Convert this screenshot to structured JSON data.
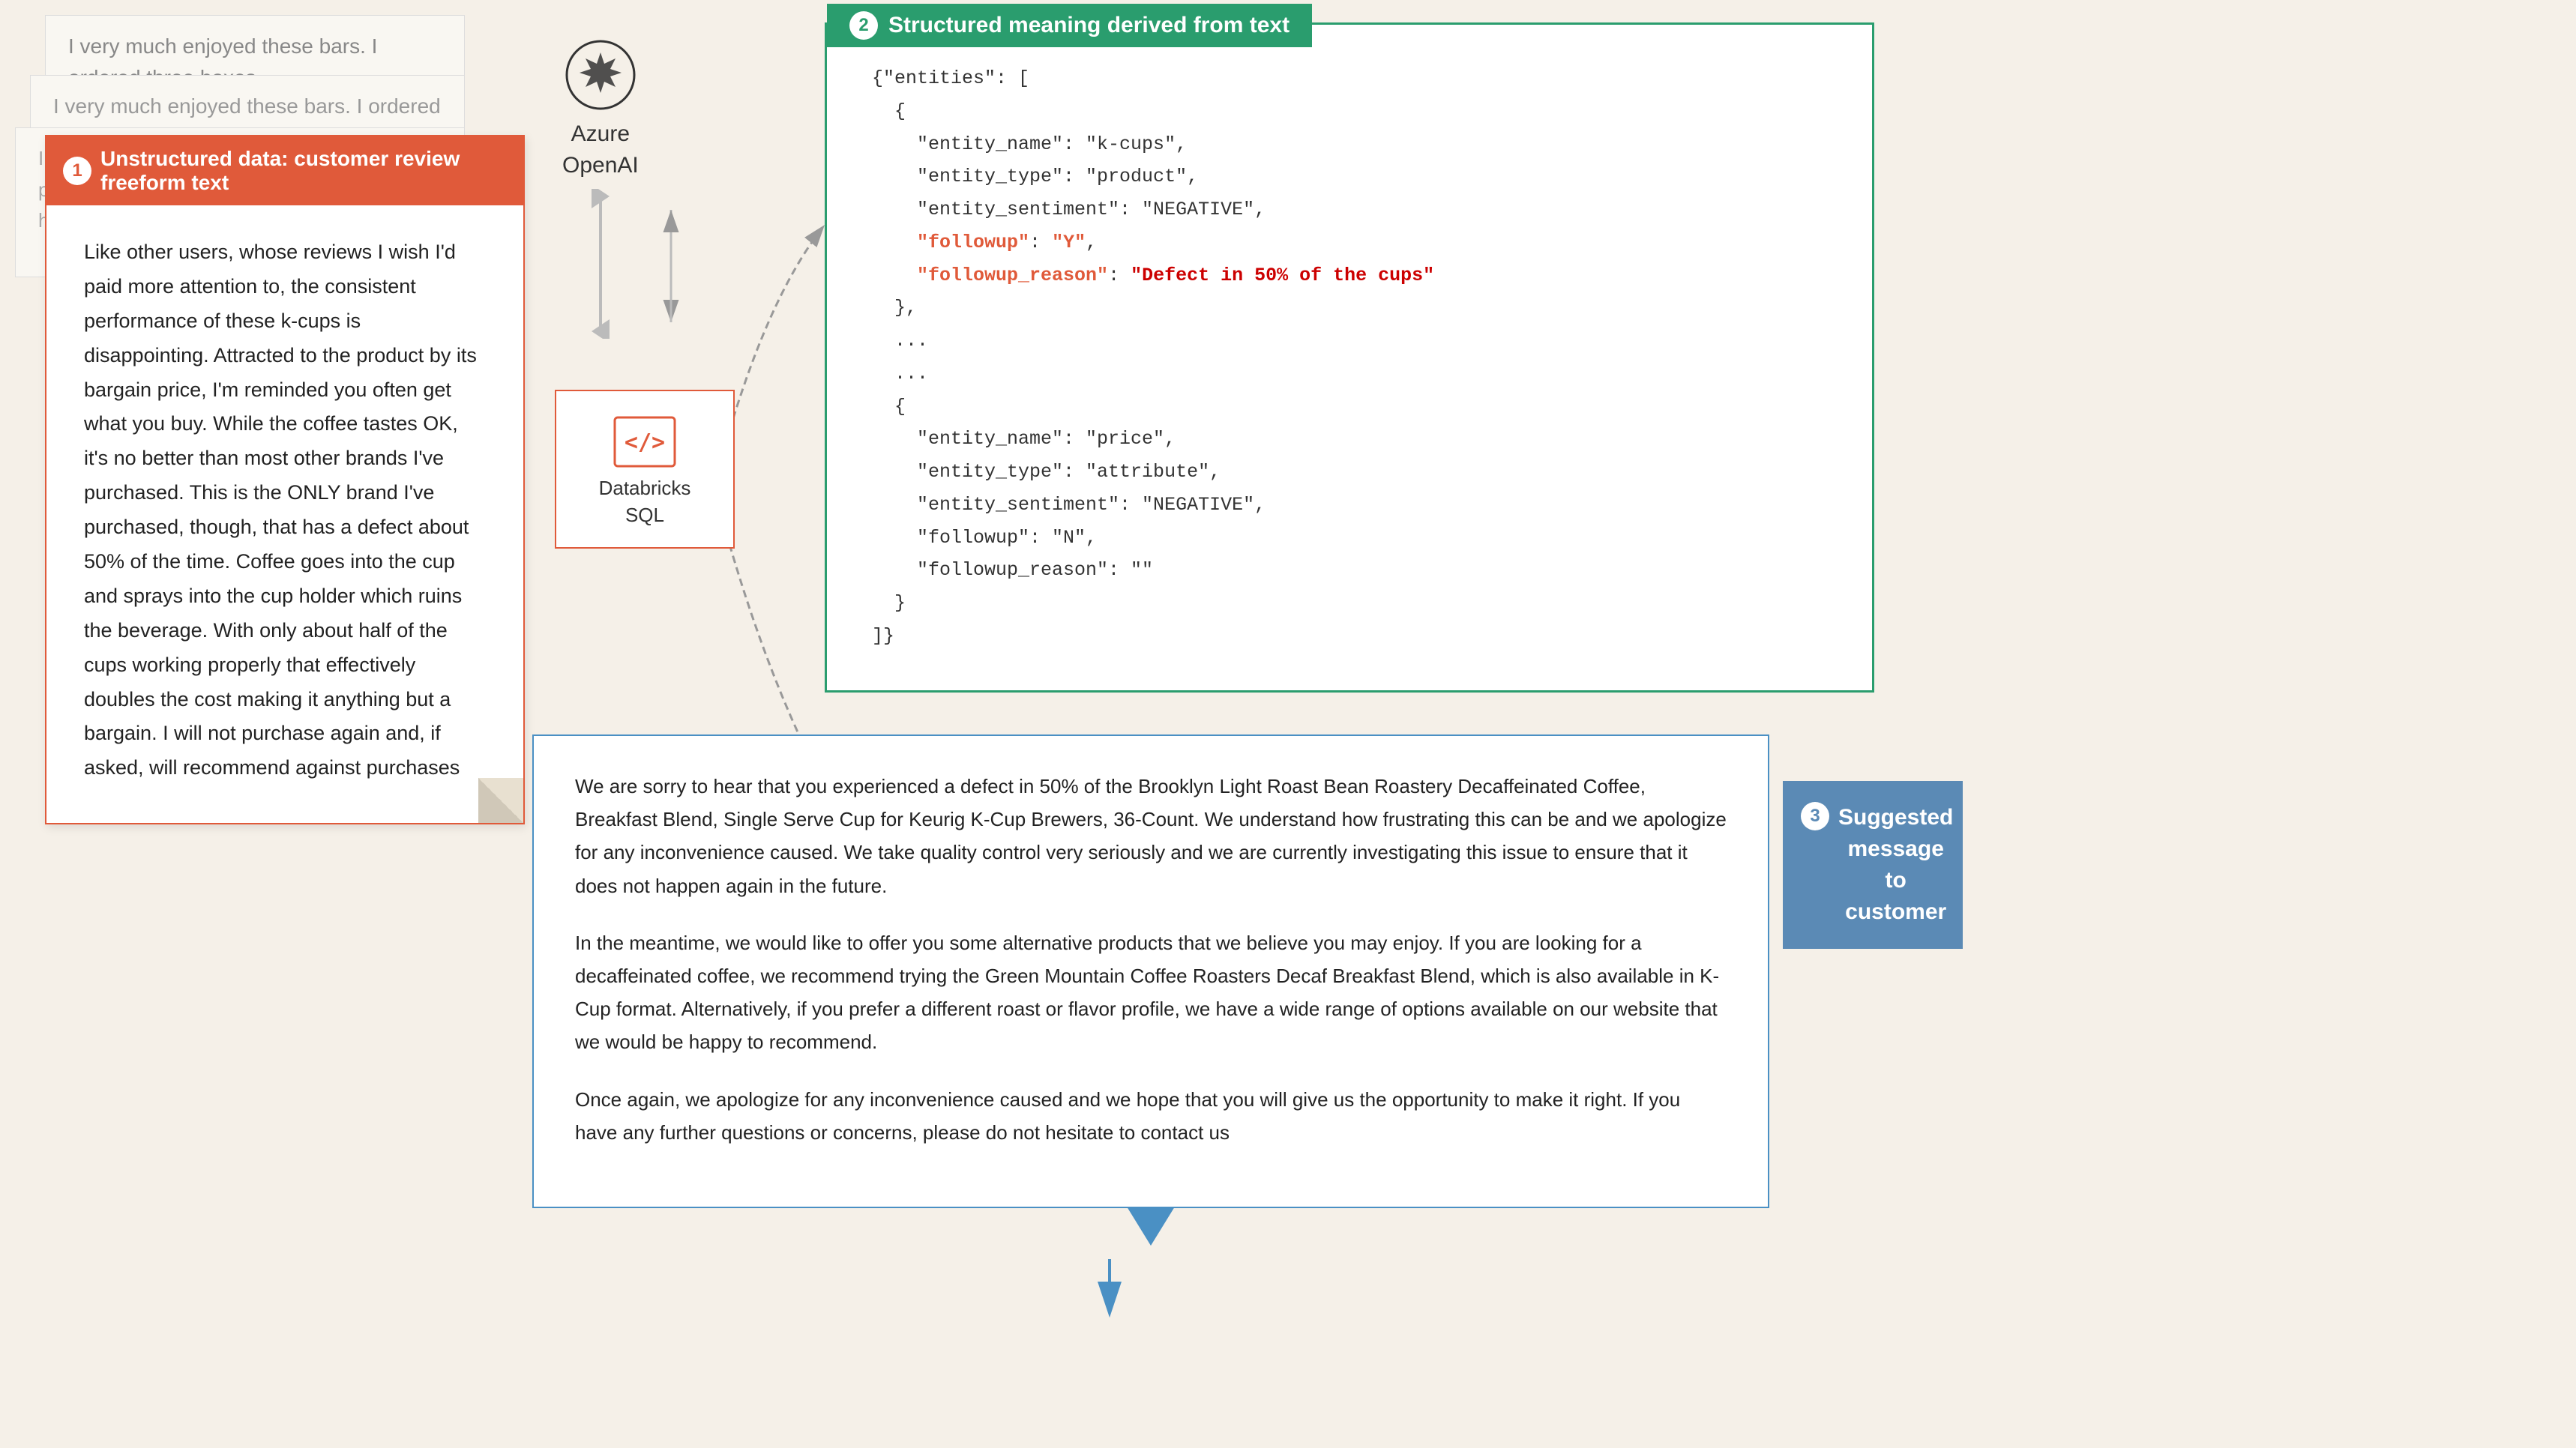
{
  "background_papers": {
    "paper1_text": "I very much enjoyed these bars. I ordered three boxes",
    "paper2_text": "I very much enjoyed these bars. I ordered three boxes",
    "paper3_text": "I first tried the regular Promax bar when I picked one up at a Trader Joes. I needed to have som..."
  },
  "review_card": {
    "label_number": "1",
    "label_text": "Unstructured data: customer review freeform text",
    "body_text": "Like other users, whose reviews I wish I'd paid more attention to, the consistent performance of these k-cups is disappointing. Attracted to the product by its bargain price, I'm reminded you often get what you buy. While the coffee tastes OK, it's no better than most other brands I've purchased. This is the ONLY brand I've purchased, though, that has a defect about 50% of the time. Coffee goes into the cup and sprays into the cup holder which ruins the beverage. With only about half of the cups working properly that effectively doubles the cost making it anything but a bargain. I will not purchase again and, if asked, will recommend against purchases"
  },
  "azure_openai": {
    "label_line1": "Azure",
    "label_line2": "OpenAI"
  },
  "databricks": {
    "label_line1": "Databricks",
    "label_line2": "SQL"
  },
  "json_panel": {
    "label_number": "2",
    "label_text": "Structured meaning derived from text",
    "json_lines": [
      "{\"entities\": [",
      "  {",
      "    \"entity_name\": \"k-cups\",",
      "    \"entity_type\": \"product\",",
      "    \"entity_sentiment\": \"NEGATIVE\",",
      "    \"followup\": \"Y\",",
      "    \"followup_reason\": \"Defect in 50% of the cups\"",
      "  },",
      "  ...",
      "  ...",
      "  {",
      "    \"entity_name\": \"price\",",
      "    \"entity_type\": \"attribute\",",
      "    \"entity_sentiment\": \"NEGATIVE\",",
      "    \"followup\": \"N\",",
      "    \"followup_reason\": \"\"",
      "  }",
      "]}"
    ]
  },
  "message_panel": {
    "label_number": "3",
    "label_text": "Suggested message to customer",
    "paragraph1": "We are sorry to hear that you experienced a defect in 50% of the Brooklyn Light Roast Bean Roastery Decaffeinated Coffee, Breakfast Blend, Single Serve Cup for Keurig K-Cup Brewers, 36-Count. We understand how frustrating this can be and we apologize for any inconvenience caused. We take quality control very seriously and we are currently investigating this issue to ensure that it does not happen again in the future.",
    "paragraph2": "In the meantime, we would like to offer you some alternative products that we believe you may enjoy. If you are looking for a decaffeinated coffee, we recommend trying the Green Mountain Coffee Roasters Decaf Breakfast Blend, which is also available in K-Cup format. Alternatively, if you prefer a different roast or flavor profile, we have a wide range of options available on our website that we would be happy to recommend.",
    "paragraph3": "Once again, we apologize for any inconvenience caused and we hope that you will give us the opportunity to make it right. If you have any further questions or concerns, please do not hesitate to contact us"
  }
}
